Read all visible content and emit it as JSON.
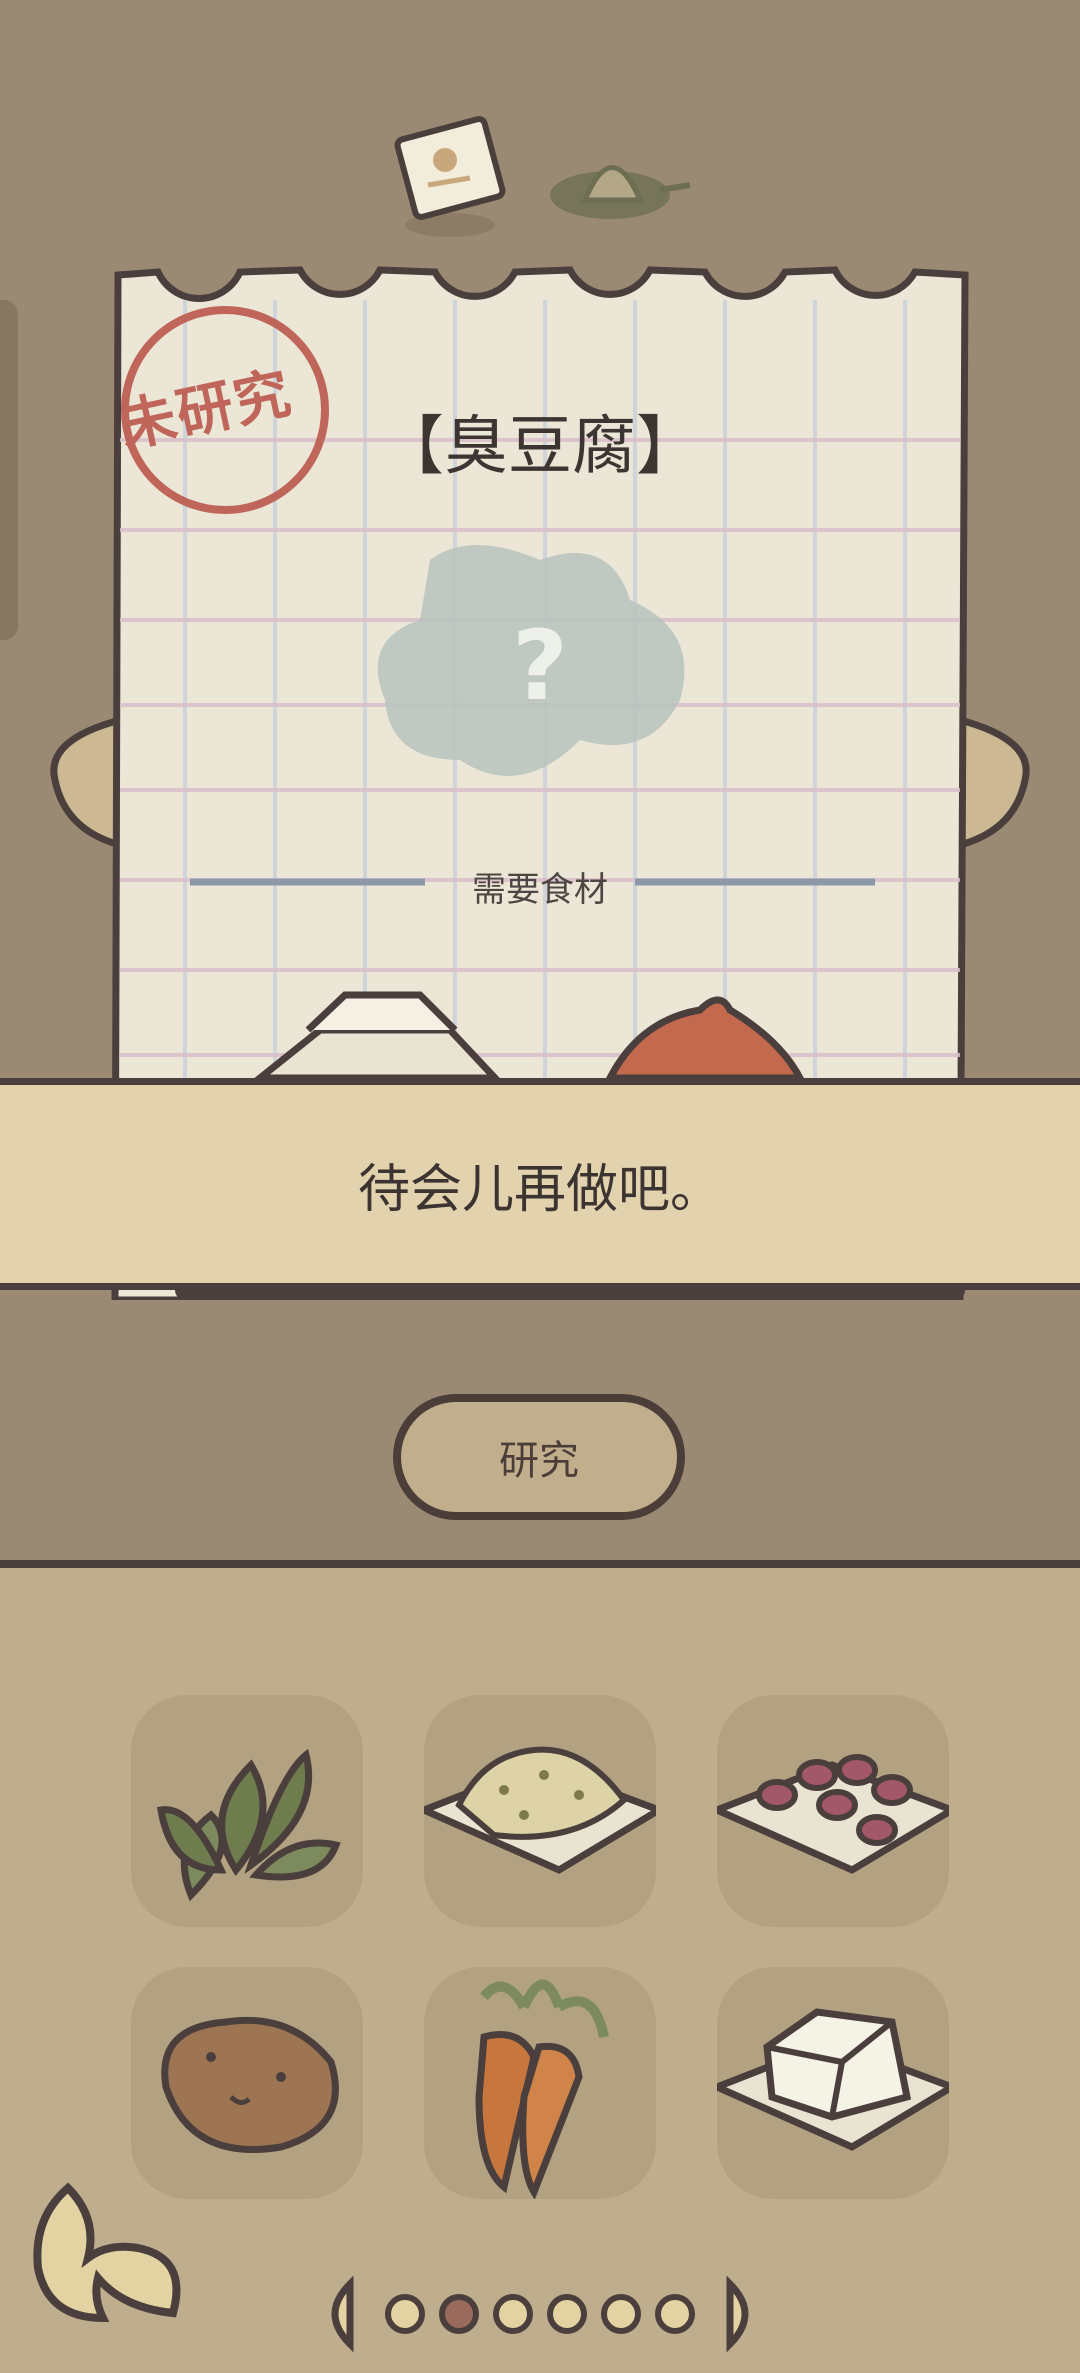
{
  "recipe": {
    "stamp": "未研究",
    "title": "【臭豆腐】",
    "unknown_symbol": "?",
    "required_label": "需要食材"
  },
  "dialog": {
    "text": "待会儿再做吧。"
  },
  "actions": {
    "research_label": "研究"
  },
  "ingredients": [
    {
      "name": "basil-leaves",
      "icon": "leaf-icon"
    },
    {
      "name": "mashed-beans",
      "icon": "grain-plate-icon"
    },
    {
      "name": "red-beans",
      "icon": "red-bean-plate-icon"
    },
    {
      "name": "potato",
      "icon": "potato-icon"
    },
    {
      "name": "carrot",
      "icon": "carrot-icon"
    },
    {
      "name": "tofu",
      "icon": "tofu-plate-icon"
    }
  ],
  "pager": {
    "total": 6,
    "current": 2
  },
  "colors": {
    "background": "#9a8a73",
    "paper": "#ebe6d6",
    "stamp": "#c0655a",
    "dialog": "#e2d3ae",
    "ingredient_panel": "#bfae8d",
    "outline": "#4a3f3c"
  }
}
